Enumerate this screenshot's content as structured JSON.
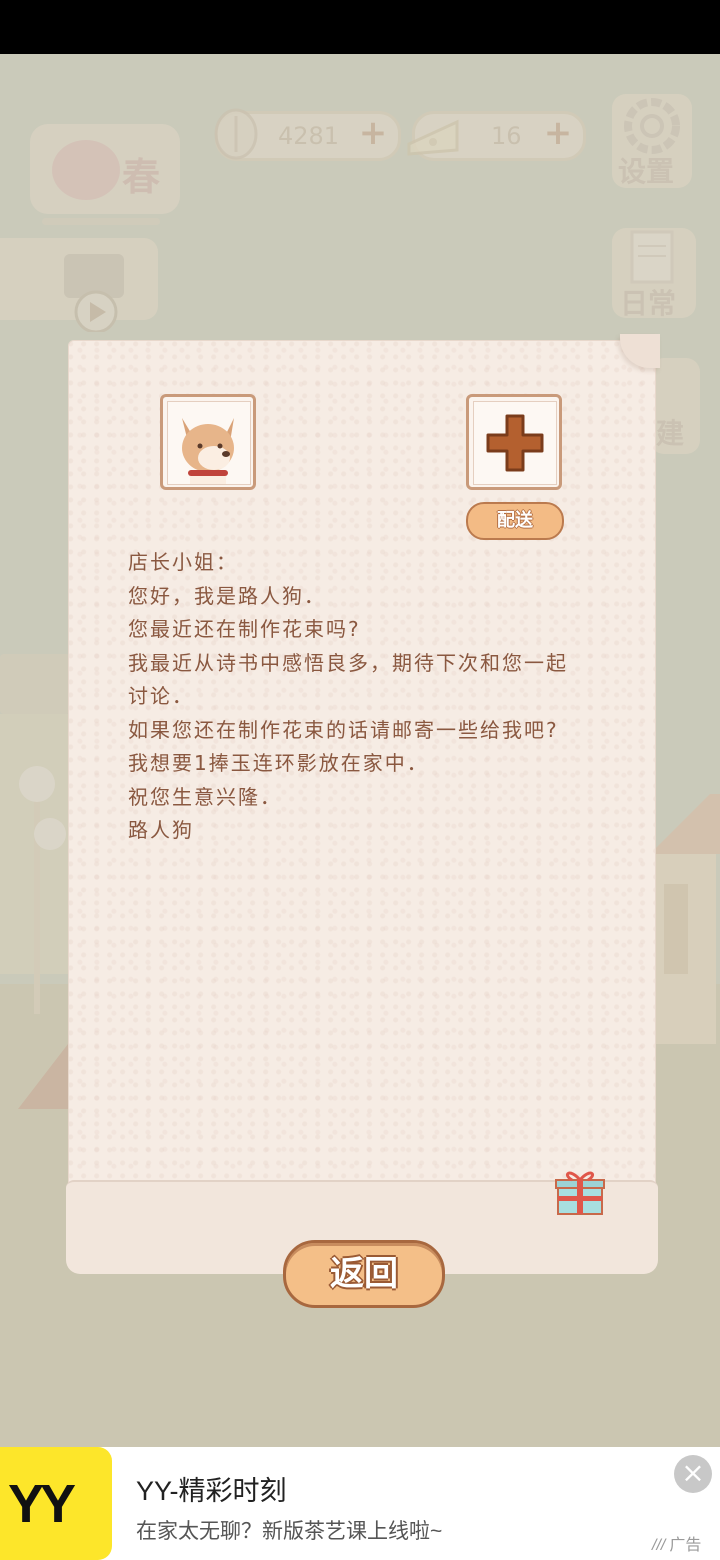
{
  "hud": {
    "season": "春",
    "fish_count": "4281",
    "cheese_count": "16",
    "settings_label": "设置",
    "daily_label": "日常",
    "build_label": "建"
  },
  "letter": {
    "deliver_label": "配送",
    "lines": [
      "店长小姐：",
      "您好，我是路人狗．",
      "您最近还在制作花束吗?",
      "我最近从诗书中感悟良多，期待下次和您一起",
      "讨论．",
      "如果您还在制作花束的话请邮寄一些给我吧?",
      "我想要1捧玉连环影放在家中．",
      "祝您生意兴隆．",
      "路人狗"
    ],
    "back_label": "返回"
  },
  "ad": {
    "logo_text": "YY",
    "title": "YY-精彩时刻",
    "description": "在家太无聊？新版茶艺课上线啦~",
    "tag": "广告"
  },
  "colors": {
    "accent_orange": "#f4bf88",
    "text_brown": "#8a5840",
    "ad_yellow": "#fde62a"
  }
}
